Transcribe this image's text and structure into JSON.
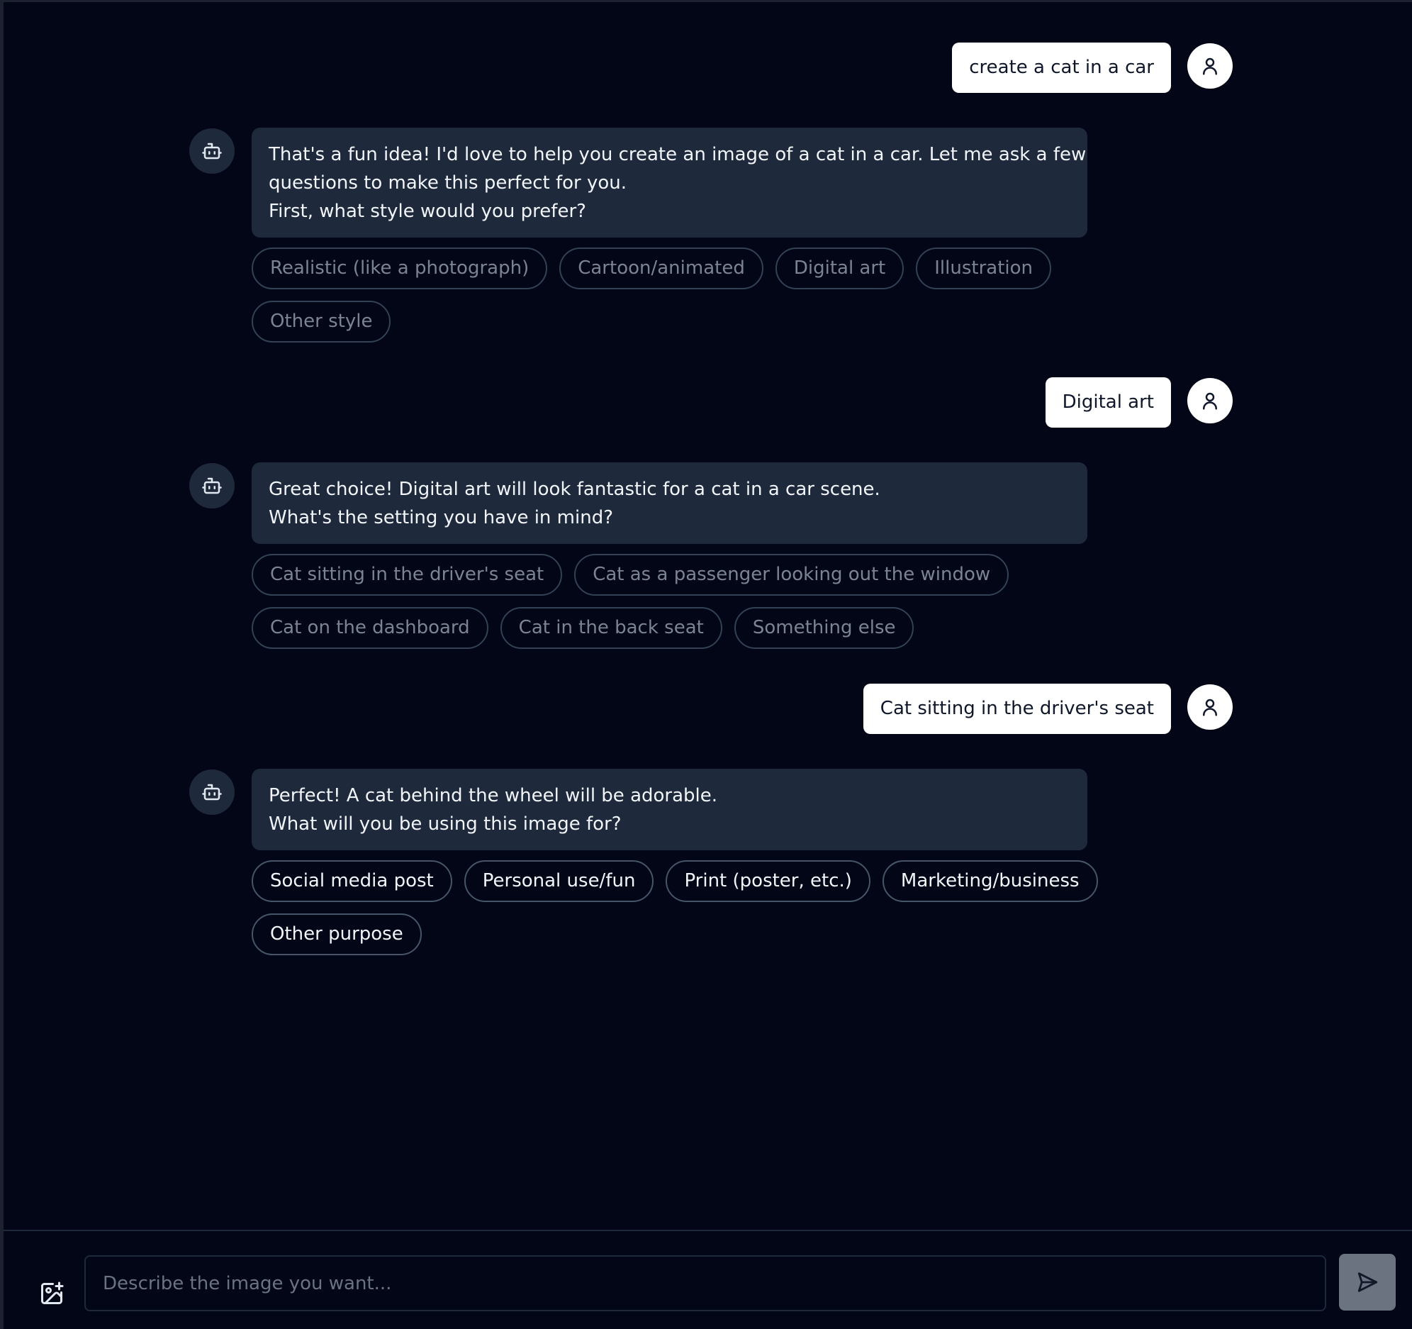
{
  "conversation": [
    {
      "role": "user",
      "text": "create a cat in a car"
    },
    {
      "role": "assistant",
      "lines": [
        "That's a fun idea! I'd love to help you create an image of a cat in a car. Let me ask a few",
        "questions to make this perfect for you.",
        "First, what style would you prefer?"
      ],
      "options": [
        "Realistic (like a photograph)",
        "Cartoon/animated",
        "Digital art",
        "Illustration",
        "Other style"
      ]
    },
    {
      "role": "user",
      "text": "Digital art"
    },
    {
      "role": "assistant",
      "lines": [
        "Great choice! Digital art will look fantastic for a cat in a car scene.",
        "What's the setting you have in mind?"
      ],
      "options": [
        "Cat sitting in the driver's seat",
        "Cat as a passenger looking out the window",
        "Cat on the dashboard",
        "Cat in the back seat",
        "Something else"
      ]
    },
    {
      "role": "user",
      "text": "Cat sitting in the driver's seat"
    },
    {
      "role": "assistant",
      "lines": [
        "Perfect! A cat behind the wheel will be adorable.",
        "What will you be using this image for?"
      ],
      "options": [
        "Social media post",
        "Personal use/fun",
        "Print (poster, etc.)",
        "Marketing/business",
        "Other purpose"
      ]
    }
  ],
  "composer": {
    "placeholder": "Describe the image you want..."
  },
  "icons": {
    "user_avatar": "user-icon",
    "bot_avatar": "bot-icon",
    "attach": "image-plus-icon",
    "send": "send-icon"
  },
  "colors": {
    "background": "#020617",
    "bot_bubble": "#1e293b",
    "user_bubble": "#ffffff",
    "send_button": "#6b7280"
  }
}
